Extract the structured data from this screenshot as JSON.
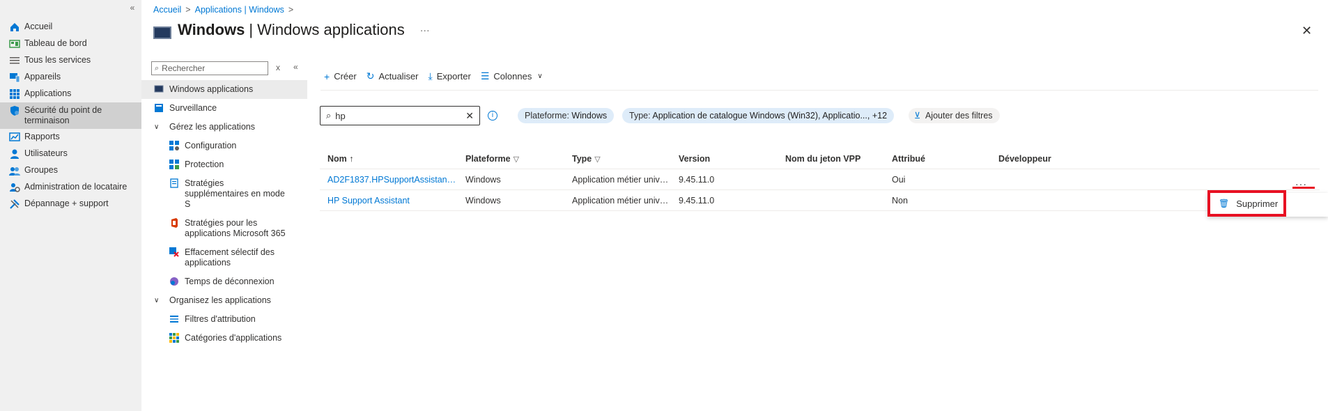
{
  "nav": {
    "collapse": "«",
    "items": [
      {
        "label": "Accueil",
        "icon": "home-icon"
      },
      {
        "label": "Tableau de bord",
        "icon": "dashboard-icon"
      },
      {
        "label": "Tous les services",
        "icon": "list-icon"
      },
      {
        "label": "Appareils",
        "icon": "devices-icon"
      },
      {
        "label": "Applications",
        "icon": "apps-grid-icon"
      },
      {
        "label": "Sécurité du point de terminaison",
        "icon": "shield-icon"
      },
      {
        "label": "Rapports",
        "icon": "reports-icon"
      },
      {
        "label": "Utilisateurs",
        "icon": "user-icon"
      },
      {
        "label": "Groupes",
        "icon": "groups-icon"
      },
      {
        "label": "Administration de locataire",
        "icon": "tenant-admin-icon"
      },
      {
        "label": "Dépannage + support",
        "icon": "wrench-icon"
      }
    ]
  },
  "breadcrumb": {
    "items": [
      "Accueil",
      "Applications | Windows"
    ],
    "sep": ">"
  },
  "header": {
    "title_strong": "Windows",
    "title_rest": "| Windows applications",
    "more": "···",
    "close": "✕"
  },
  "menu": {
    "search_placeholder": "Rechercher",
    "clear": "x",
    "collapse": "«",
    "items": [
      {
        "label": "Windows applications",
        "kind": "top",
        "icon": "windows-app-icon"
      },
      {
        "label": "Surveillance",
        "kind": "top",
        "icon": "monitor-icon"
      },
      {
        "label": "Gérez les applications",
        "kind": "group"
      },
      {
        "label": "Configuration",
        "kind": "sub",
        "icon": "configuration-icon"
      },
      {
        "label": "Protection",
        "kind": "sub",
        "icon": "protection-icon"
      },
      {
        "label": "Stratégies supplémentaires en mode S",
        "kind": "sub",
        "icon": "s-mode-policy-icon"
      },
      {
        "label": "Stratégies pour les applications Microsoft 365",
        "kind": "sub",
        "icon": "office-icon"
      },
      {
        "label": "Effacement sélectif des applications",
        "kind": "sub",
        "icon": "selective-wipe-icon"
      },
      {
        "label": "Temps de déconnexion",
        "kind": "sub",
        "icon": "timeout-icon"
      },
      {
        "label": "Organisez les applications",
        "kind": "group"
      },
      {
        "label": "Filtres d'attribution",
        "kind": "sub",
        "icon": "filter-icon"
      },
      {
        "label": "Catégories d'applications",
        "kind": "sub",
        "icon": "categories-icon"
      }
    ]
  },
  "toolbar": {
    "create": "Créer",
    "refresh": "Actualiser",
    "export": "Exporter",
    "columns": "Colonnes"
  },
  "filter": {
    "value": "hp",
    "pill_platform_label": "Plateforme:",
    "pill_platform_value": "Windows",
    "pill_type_label": "Type:",
    "pill_type_value": "Application de catalogue Windows (Win32), Applicatio..., +12",
    "add_filters": "Ajouter des filtres"
  },
  "table": {
    "headers": [
      "Nom ↑",
      "Plateforme",
      "Type",
      "Version",
      "Nom du jeton VPP",
      "Attribué",
      "Développeur"
    ],
    "rows": [
      [
        "AD2F1837.HPSupportAssistant ...",
        "Windows",
        "Application métier unive...",
        "9.45.11.0",
        "",
        "Oui",
        ""
      ],
      [
        "HP Support Assistant",
        "Windows",
        "Application métier unive...",
        "9.45.11.0",
        "",
        "Non",
        ""
      ]
    ]
  },
  "context_menu": {
    "more": "···",
    "delete": "Supprimer"
  },
  "colors": {
    "accent": "#0078d4",
    "highlight": "#e81123",
    "pill": "#deecf9"
  }
}
